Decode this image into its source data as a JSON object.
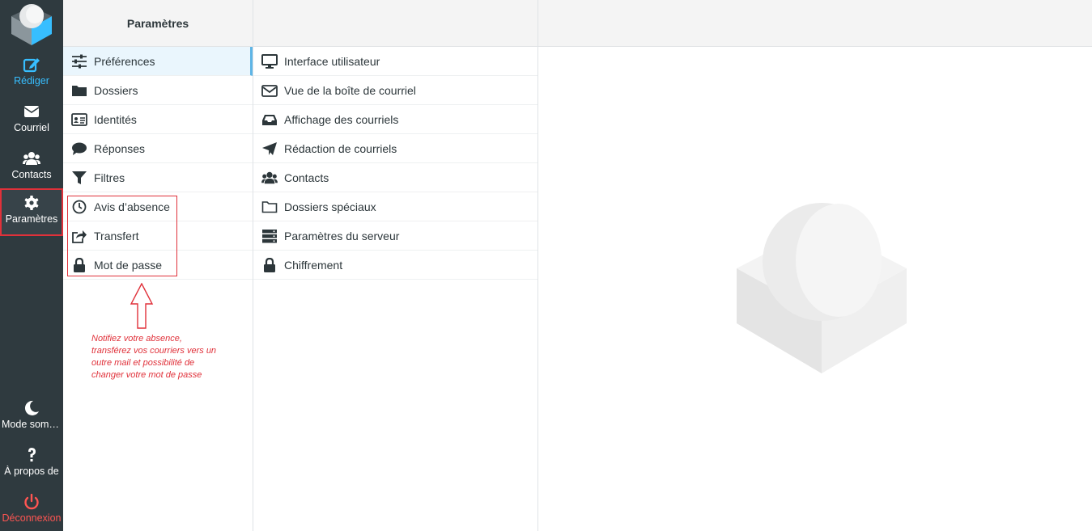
{
  "nav": {
    "items": [
      {
        "label": "Rédiger",
        "icon": "compose-icon"
      },
      {
        "label": "Courriel",
        "icon": "envelope-icon"
      },
      {
        "label": "Contacts",
        "icon": "users-icon"
      },
      {
        "label": "Paramètres",
        "icon": "gear-icon"
      }
    ],
    "bottom": [
      {
        "label": "Mode sombre",
        "icon": "moon-icon"
      },
      {
        "label": "À propos de",
        "icon": "question-icon"
      },
      {
        "label": "Déconnexion",
        "icon": "power-icon"
      }
    ]
  },
  "settings": {
    "title": "Paramètres",
    "items": [
      {
        "label": "Préférences",
        "icon": "sliders-icon"
      },
      {
        "label": "Dossiers",
        "icon": "folder-icon"
      },
      {
        "label": "Identités",
        "icon": "id-card-icon"
      },
      {
        "label": "Réponses",
        "icon": "comment-icon"
      },
      {
        "label": "Filtres",
        "icon": "filter-icon"
      },
      {
        "label": "Avis d’absence",
        "icon": "clock-icon"
      },
      {
        "label": "Transfert",
        "icon": "share-icon"
      },
      {
        "label": "Mot de passe",
        "icon": "lock-icon"
      }
    ]
  },
  "preferences": {
    "items": [
      {
        "label": "Interface utilisateur",
        "icon": "monitor-icon"
      },
      {
        "label": "Vue de la boîte de courriel",
        "icon": "envelope-outline-icon"
      },
      {
        "label": "Affichage des courriels",
        "icon": "inbox-icon"
      },
      {
        "label": "Rédaction de courriels",
        "icon": "paper-plane-icon"
      },
      {
        "label": "Contacts",
        "icon": "users-icon"
      },
      {
        "label": "Dossiers spéciaux",
        "icon": "folder-outline-icon"
      },
      {
        "label": "Paramètres du serveur",
        "icon": "server-icon"
      },
      {
        "label": "Chiffrement",
        "icon": "lock-icon"
      }
    ]
  },
  "annotation": {
    "text": "Notifiez votre absence,\ntransférez vos courriers vers un\noutre mail et possibilité de\nchanger votre mot  de passe"
  },
  "colors": {
    "nav_bg": "#2f3a3f",
    "accent": "#37beff",
    "danger": "#ff5552",
    "annotation": "#e0313a"
  }
}
